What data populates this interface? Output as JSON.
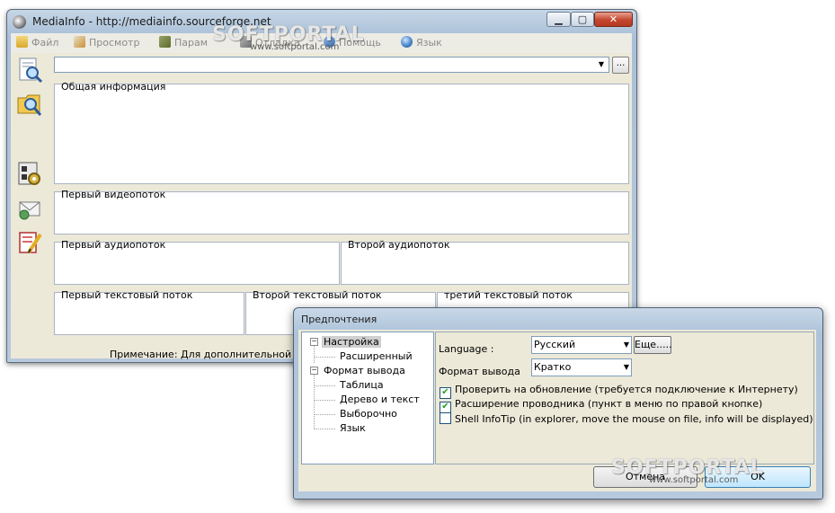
{
  "main_window": {
    "title": "MediaInfo - http://mediainfo.sourceforge.net",
    "controls": {
      "minimize": "▁",
      "maximize": "▢",
      "close": "✕"
    },
    "menu": [
      {
        "label": "Файл",
        "icon": "folder-icon"
      },
      {
        "label": "Просмотр",
        "icon": "view-icon"
      },
      {
        "label": "Парам",
        "icon": "options-icon"
      },
      {
        "label": "Отладка",
        "icon": "debug-icon"
      },
      {
        "label": "Помощь",
        "icon": "help-icon"
      },
      {
        "label": "Язык",
        "icon": "globe-icon"
      }
    ],
    "browse_button": "...",
    "file_combo_value": "",
    "panels": {
      "general": "Общая информация",
      "video1": "Первый видеопоток",
      "audio1": "Первый аудиопоток",
      "audio2": "Второй аудиопоток",
      "text1": "Первый текстовый поток",
      "text2": "Второй текстовый поток",
      "text3": "третий текстовый поток"
    },
    "note": "Примечание: Для дополнительной и"
  },
  "preferences": {
    "title": "Предпочтения",
    "tree": {
      "setup": "Настройка",
      "advanced": "Расширенный",
      "output_format": "Формат вывода",
      "table": "Таблица",
      "tree_text": "Дерево и текст",
      "custom": "Выборочно",
      "language": "Язык"
    },
    "language_label": "Language :",
    "language_value": "Русский",
    "more_button": "Еще.....",
    "output_label": "Формат вывода",
    "output_value": "Кратко",
    "checkboxes": [
      {
        "label": "Проверить на обновление (требуется подключение к Интернету)",
        "checked": true
      },
      {
        "label": "Расширение проводника (пункт в меню по правой кнопке)",
        "checked": true
      },
      {
        "label": "Shell InfoTip (in explorer, move the mouse on file, info will be displayed)",
        "checked": false
      }
    ],
    "cancel_button": "Отмена",
    "ok_button": "OK"
  },
  "watermark": {
    "logo": "SOFTPORTAL",
    "url": "www.softportal.com"
  }
}
